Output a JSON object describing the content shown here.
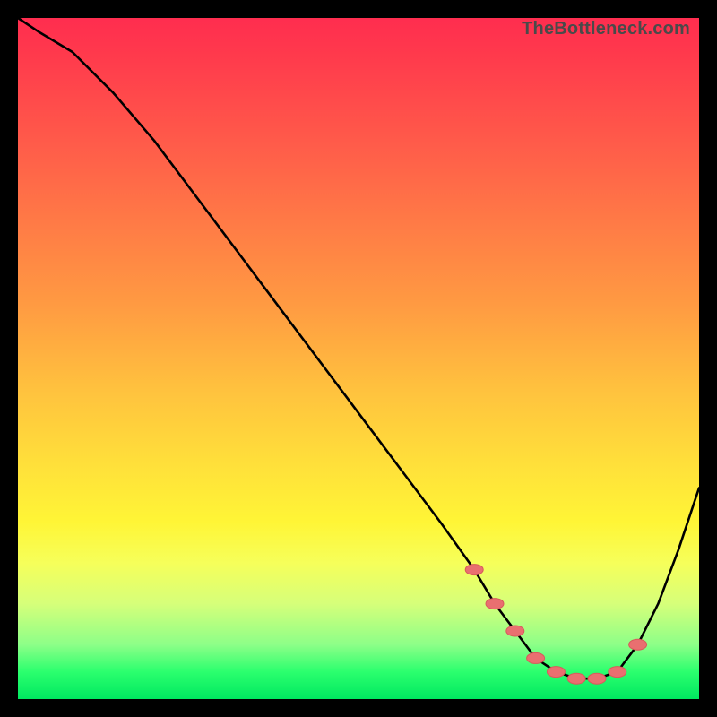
{
  "watermark": "TheBottleneck.com",
  "colors": {
    "background": "#000000",
    "gradient_top": "#ff2d4f",
    "gradient_bottom": "#00e860",
    "curve": "#000000",
    "marker_fill": "#e96f70",
    "marker_stroke": "#d85a5b"
  },
  "chart_data": {
    "type": "line",
    "title": "",
    "xlabel": "",
    "ylabel": "",
    "xlim": [
      0,
      100
    ],
    "ylim": [
      0,
      100
    ],
    "series": [
      {
        "name": "bottleneck-curve",
        "x": [
          0,
          3,
          8,
          14,
          20,
          26,
          32,
          38,
          44,
          50,
          56,
          62,
          67,
          70,
          73,
          76,
          79,
          82,
          85,
          88,
          91,
          94,
          97,
          100
        ],
        "y": [
          100,
          98,
          95,
          89,
          82,
          74,
          66,
          58,
          50,
          42,
          34,
          26,
          19,
          14,
          10,
          6,
          4,
          3,
          3,
          4,
          8,
          14,
          22,
          31
        ]
      }
    ],
    "markers": {
      "name": "highlight-band",
      "x": [
        67,
        70,
        73,
        76,
        79,
        82,
        85,
        88,
        91
      ],
      "y": [
        19,
        14,
        10,
        6,
        4,
        3,
        3,
        4,
        8
      ]
    }
  }
}
